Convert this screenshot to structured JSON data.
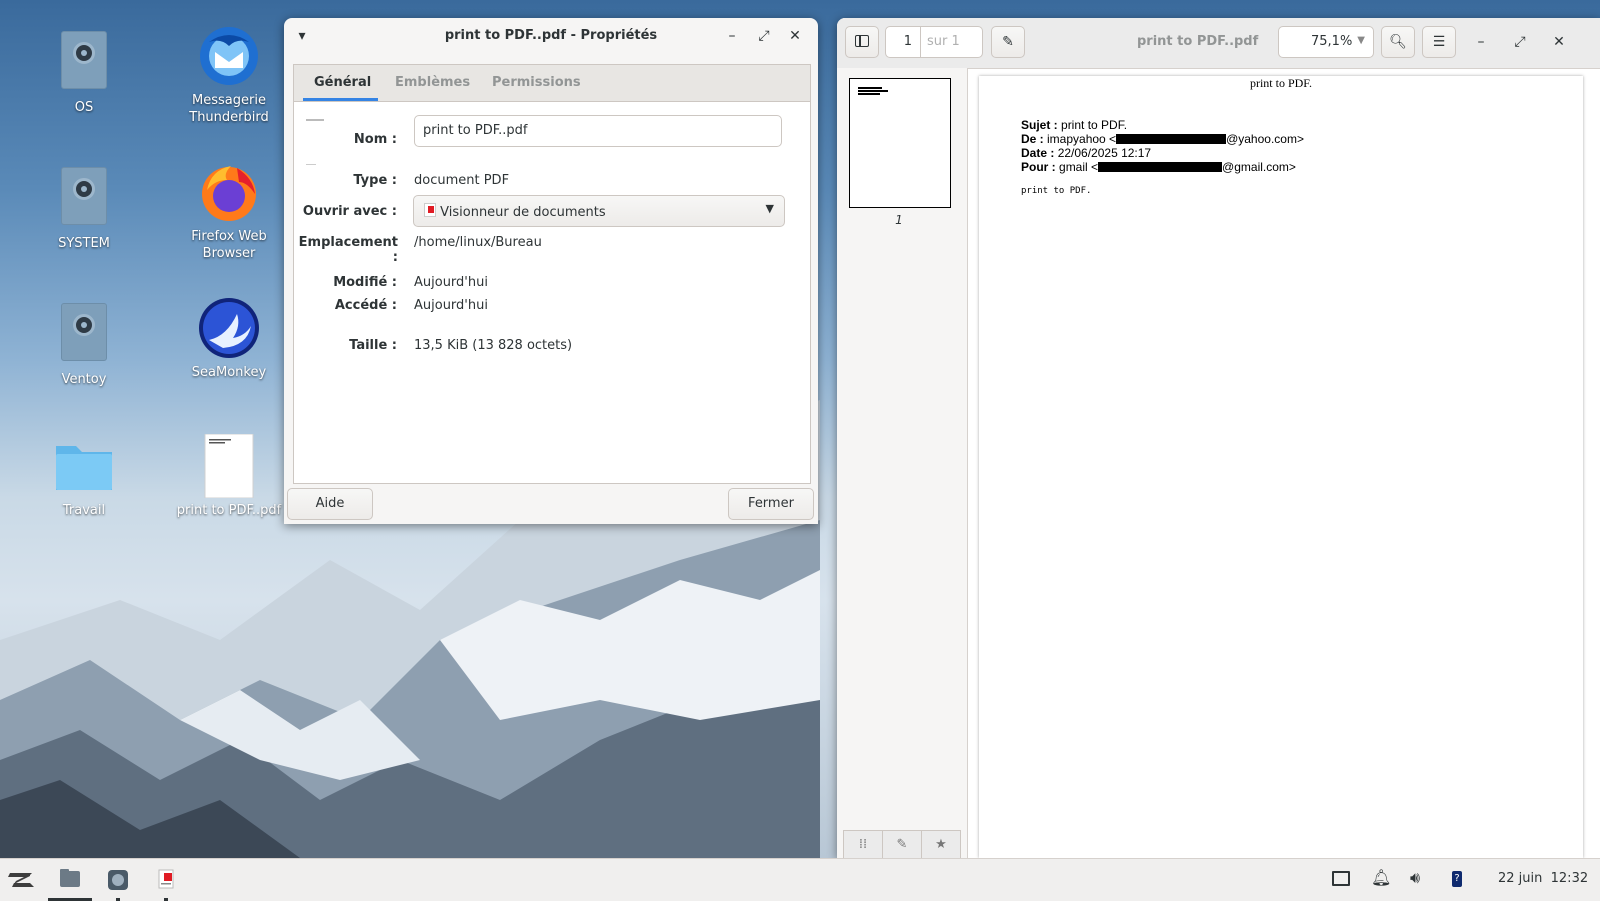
{
  "desktop": {
    "icons": [
      {
        "label": "OS",
        "icon": "drive-icon"
      },
      {
        "label": "Messagerie Thunderbird",
        "icon": "thunderbird-icon"
      },
      {
        "label": "SYSTEM",
        "icon": "drive-icon"
      },
      {
        "label": "Firefox Web Browser",
        "icon": "firefox-icon"
      },
      {
        "label": "Ventoy",
        "icon": "drive-icon"
      },
      {
        "label": "SeaMonkey",
        "icon": "seamonkey-icon"
      },
      {
        "label": "Travail",
        "icon": "folder-icon"
      },
      {
        "label": "print to PDF..pdf",
        "icon": "pdf-file-icon"
      }
    ]
  },
  "dialog": {
    "title": "print to PDF..pdf - Propriétés",
    "tabs": [
      "Général",
      "Emblèmes",
      "Permissions"
    ],
    "active_tab": "Général",
    "fields": {
      "name_label": "Nom :",
      "name_value": "print to PDF..pdf",
      "type_label": "Type :",
      "type_value": "document PDF",
      "open_label": "Ouvrir avec :",
      "open_value": "Visionneur de documents",
      "location_label": "Emplacement :",
      "location_value": "/home/linux/Bureau",
      "modified_label": "Modifié :",
      "modified_value": "Aujourd'hui",
      "accessed_label": "Accédé :",
      "accessed_value": "Aujourd'hui",
      "size_label": "Taille :",
      "size_value": "13,5 KiB (13 828 octets)"
    },
    "help_button": "Aide",
    "close_button": "Fermer"
  },
  "viewer": {
    "title": "print to PDF..pdf",
    "page_number": "1",
    "page_total": "sur 1",
    "zoom": "75,1%",
    "thumbnail_label": "1",
    "page": {
      "heading": "print to PDF.",
      "subject_label": "Sujet :",
      "subject_value": "print to PDF.",
      "from_label": "De :",
      "from_name": "imapyahoo <",
      "from_domain": "@yahoo.com>",
      "date_label": "Date :",
      "date_value": "22/06/2025 12:17",
      "to_label": "Pour :",
      "to_name": "gmail <",
      "to_domain": "@gmail.com>",
      "body": "print to PDF."
    }
  },
  "taskbar": {
    "clock": "22 juin  12:32"
  },
  "colors": {
    "accent": "#3584e4",
    "taskbar": "#f0efee"
  }
}
